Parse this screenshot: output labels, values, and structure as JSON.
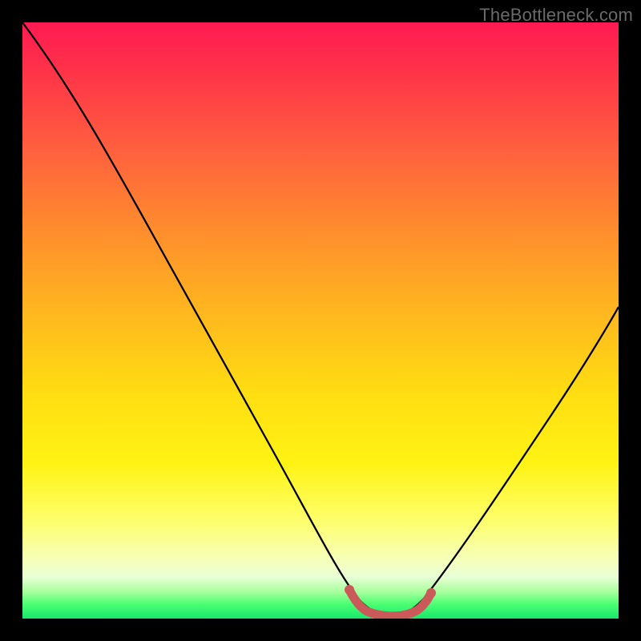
{
  "watermark": {
    "text": "TheBottleneck.com"
  },
  "colors": {
    "curve": "#000000",
    "marker": "#c95a59",
    "background_black": "#000000"
  },
  "chart_data": {
    "type": "line",
    "title": "",
    "xlabel": "",
    "ylabel": "",
    "xlim": [
      0,
      100
    ],
    "ylim": [
      0,
      100
    ],
    "grid": false,
    "legend": false,
    "series": [
      {
        "name": "bottleneck-curve",
        "x": [
          0,
          5,
          10,
          15,
          20,
          25,
          30,
          35,
          40,
          45,
          50,
          54,
          58,
          62,
          65,
          70,
          75,
          80,
          85,
          90,
          95,
          100
        ],
        "y": [
          100,
          93,
          86,
          78,
          70,
          62,
          53,
          44,
          34,
          24,
          14,
          6,
          2,
          1,
          2,
          8,
          16,
          25,
          35,
          45,
          55,
          64
        ],
        "color": "#000000"
      },
      {
        "name": "optimal-zone-marker",
        "x": [
          54,
          56,
          58,
          60,
          62,
          64,
          65
        ],
        "y": [
          6,
          3,
          2,
          1.5,
          1,
          1.5,
          2
        ],
        "color": "#c95a59"
      }
    ],
    "annotations": []
  }
}
